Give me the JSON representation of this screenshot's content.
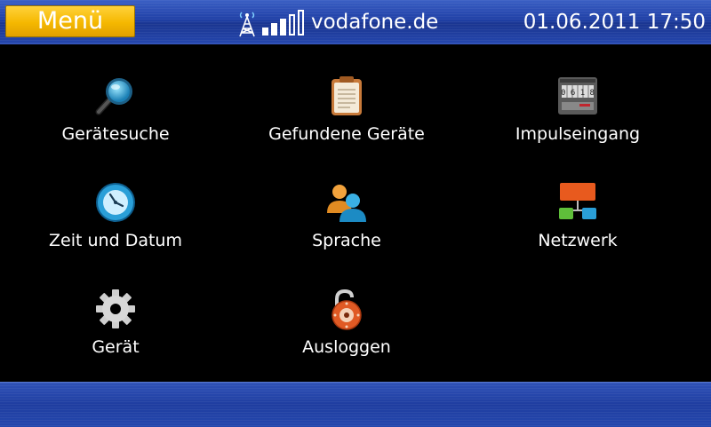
{
  "header": {
    "menu_label": "Menü",
    "carrier": "vodafone.de",
    "datetime": "01.06.2011 17:50",
    "signal_bars_filled": 3,
    "signal_bars_total": 5
  },
  "menu_items": [
    {
      "label": "Gerätesuche",
      "icon": "magnifier-icon"
    },
    {
      "label": "Gefundene Geräte",
      "icon": "clipboard-icon"
    },
    {
      "label": "Impulseingang",
      "icon": "counter-meter-icon"
    },
    {
      "label": "Zeit und Datum",
      "icon": "clock-icon"
    },
    {
      "label": "Sprache",
      "icon": "users-icon"
    },
    {
      "label": "Netzwerk",
      "icon": "network-icon"
    },
    {
      "label": "Gerät",
      "icon": "gear-icon"
    },
    {
      "label": "Ausloggen",
      "icon": "unlock-icon"
    }
  ],
  "colors": {
    "bar_blue": "#2446ad",
    "menu_yellow": "#f5b800",
    "background": "#000000"
  }
}
